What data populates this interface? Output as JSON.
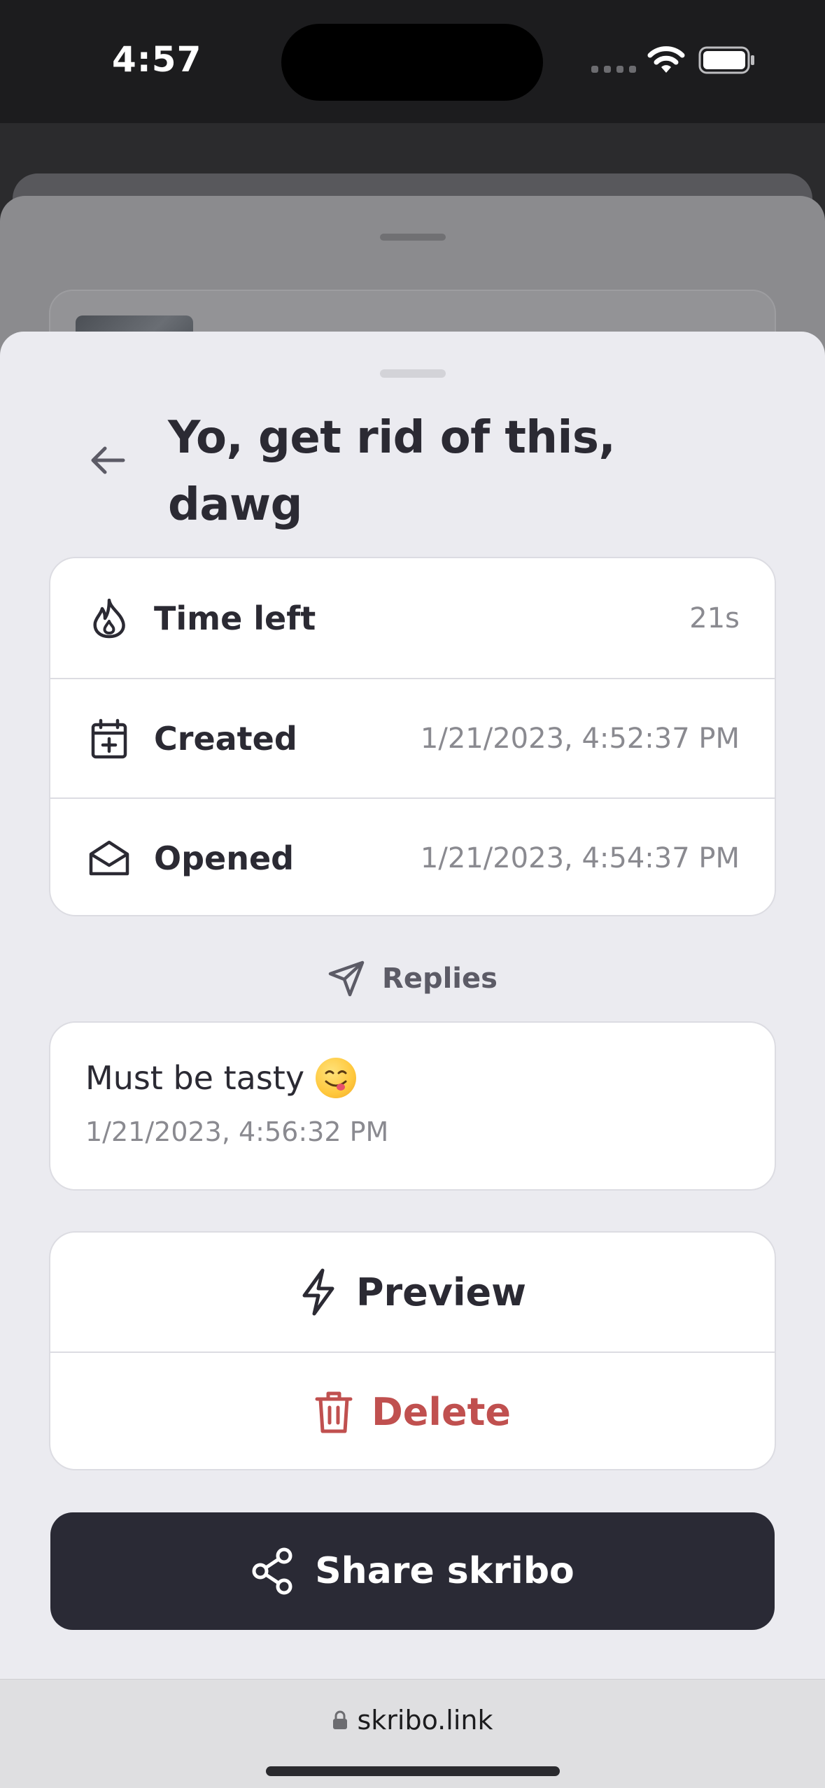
{
  "status_bar": {
    "time": "4:57"
  },
  "sheet": {
    "title": "Yo, get rid of this, dawg",
    "info": [
      {
        "label": "Time left",
        "value": "21s",
        "icon": "flame-icon"
      },
      {
        "label": "Created",
        "value": "1/21/2023, 4:52:37 PM",
        "icon": "calendar-plus-icon"
      },
      {
        "label": "Opened",
        "value": "1/21/2023, 4:54:37 PM",
        "icon": "envelope-open-icon"
      }
    ],
    "replies": {
      "label": "Replies",
      "items": [
        {
          "text": "Must be tasty",
          "emoji": "yum-emoji",
          "time": "1/21/2023, 4:56:32 PM"
        }
      ]
    },
    "actions": {
      "preview_label": "Preview",
      "delete_label": "Delete"
    },
    "share_label": "Share skribo"
  },
  "browser": {
    "url": "skribo.link"
  },
  "colors": {
    "text_primary": "#2b2a33",
    "text_secondary": "#8a8a90",
    "danger": "#c0504f",
    "share_button_bg": "#2a2a35",
    "sheet_bg": "#ebebf0"
  }
}
